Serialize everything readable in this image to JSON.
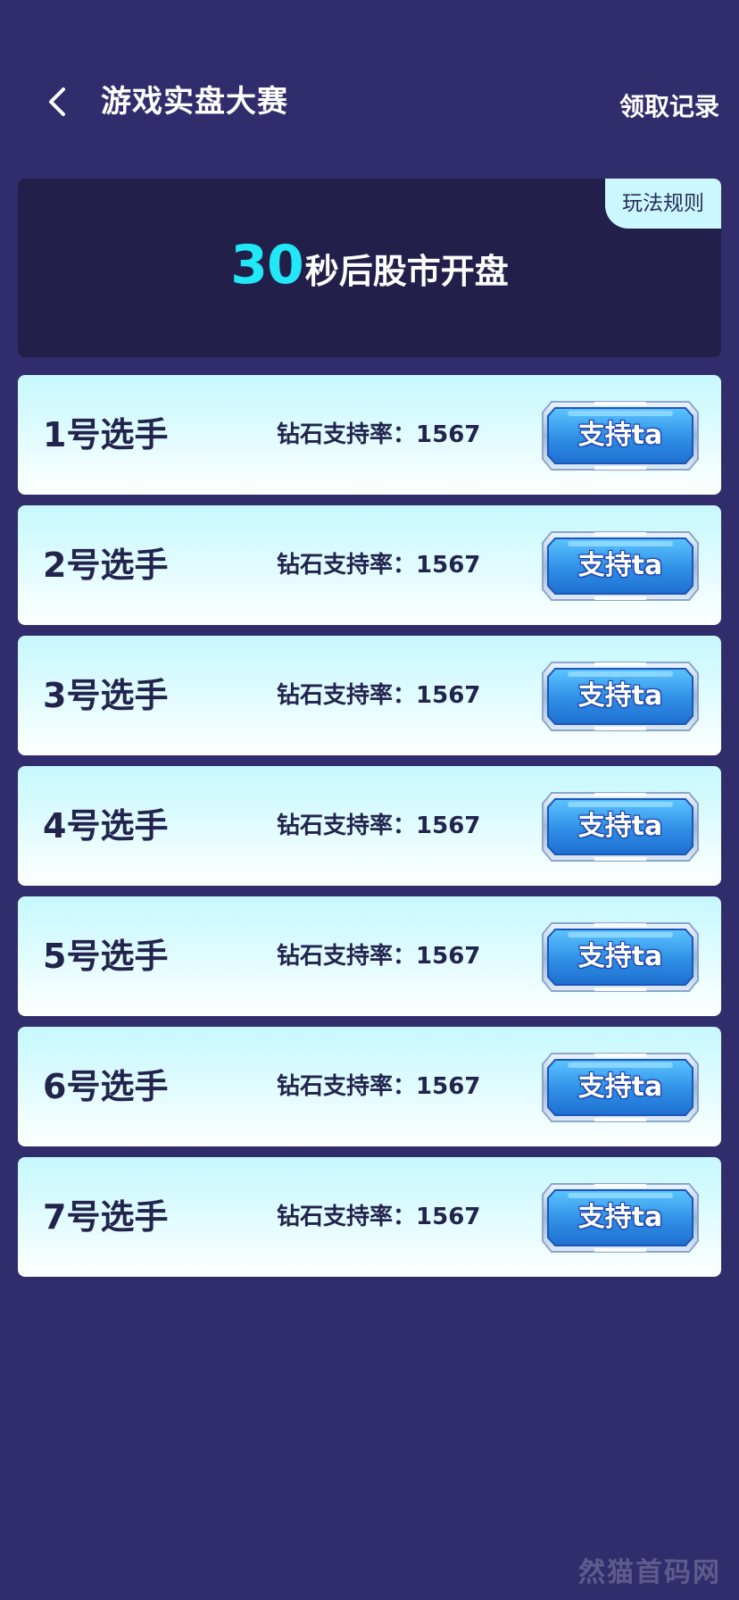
{
  "header": {
    "title": "游戏实盘大赛",
    "records_label": "领取记录"
  },
  "banner": {
    "rules_label": "玩法规则",
    "countdown_value": "30",
    "countdown_text": "秒后股市开盘"
  },
  "players": [
    {
      "name": "1号选手",
      "rate_label": "钻石支持率：",
      "rate_value": "1567",
      "button_label": "支持ta"
    },
    {
      "name": "2号选手",
      "rate_label": "钻石支持率：",
      "rate_value": "1567",
      "button_label": "支持ta"
    },
    {
      "name": "3号选手",
      "rate_label": "钻石支持率：",
      "rate_value": "1567",
      "button_label": "支持ta"
    },
    {
      "name": "4号选手",
      "rate_label": "钻石支持率：",
      "rate_value": "1567",
      "button_label": "支持ta"
    },
    {
      "name": "5号选手",
      "rate_label": "钻石支持率：",
      "rate_value": "1567",
      "button_label": "支持ta"
    },
    {
      "name": "6号选手",
      "rate_label": "钻石支持率：",
      "rate_value": "1567",
      "button_label": "支持ta"
    },
    {
      "name": "7号选手",
      "rate_label": "钻石支持率：",
      "rate_value": "1567",
      "button_label": "支持ta"
    }
  ],
  "watermark": "然猫首码网",
  "colors": {
    "background": "#312d6c",
    "banner": "#22204a",
    "accent_cyan": "#21e7f7",
    "card_top": "#c6f8fe",
    "text_dark": "#22244e",
    "button_blue": "#2f8fe6"
  },
  "icons": {
    "back": "chevron-left-icon"
  }
}
